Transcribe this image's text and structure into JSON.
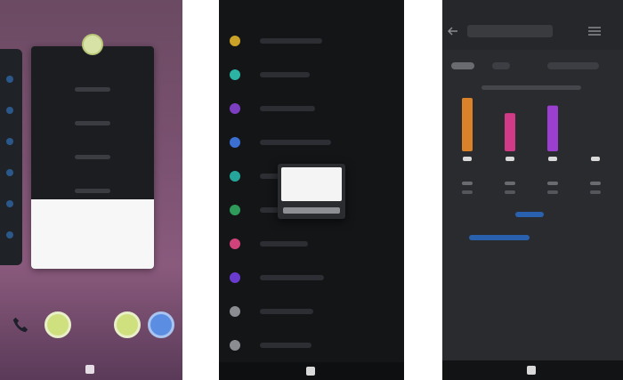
{
  "panel_launcher": {
    "icons": [
      "app-icon",
      "phone-icon",
      "app-icon",
      "app-icon",
      "app-icon"
    ],
    "colors": {
      "wallpaper": "#7c5272",
      "card": "#1c1d21"
    }
  },
  "panel_settings": {
    "item_dot_colors": [
      "#c9a227",
      "#2bb3a3",
      "#7d3fc2",
      "#3b6fd1",
      "#26a69a",
      "#2e9b5b",
      "#d0427a",
      "#6a3bcf",
      "#8a8c91",
      "#8a8c91"
    ],
    "colors": {
      "background": "#141517",
      "dialog_body": "#f4f4f4"
    }
  },
  "panel_chart": {
    "colors": {
      "background": "#2a2b2e",
      "bar_orange": "#d9822b",
      "bar_magenta": "#d03a86",
      "bar_purple": "#9a3fd0"
    }
  },
  "chart_data": {
    "type": "bar",
    "categories": [
      "",
      "",
      "",
      ""
    ],
    "values": [
      7,
      5,
      6,
      0
    ],
    "colors": [
      "#d9822b",
      "#d03a86",
      "#9a3fd0",
      "#d9d9d9"
    ],
    "title": "",
    "xlabel": "",
    "ylabel": ""
  }
}
